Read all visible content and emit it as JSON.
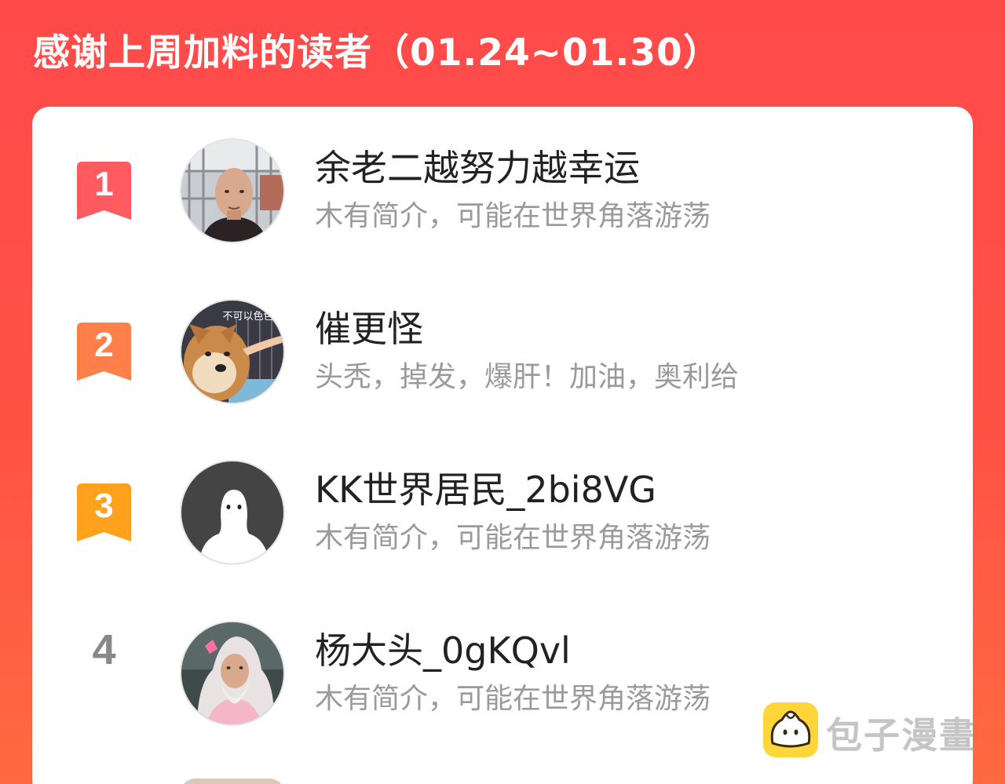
{
  "header": {
    "title": "感谢上周加料的读者（01.24~01.30）"
  },
  "readers": [
    {
      "rank": "1",
      "name": "余老二越努力越幸运",
      "bio": "木有简介，可能在世界角落游荡",
      "badge_color": "#ff5b61",
      "avatar": "photo-man-avatar"
    },
    {
      "rank": "2",
      "name": "催更怪",
      "bio": "头秃，掉发，爆肝！加油，奥利给",
      "badge_color": "#ff7f4a",
      "avatar": "shiba-dog-avatar",
      "avatar_caption": "不可以色色"
    },
    {
      "rank": "3",
      "name": "KK世界居民_2bi8VG",
      "bio": "木有简介，可能在世界角落游荡",
      "badge_color": "#ffa11c",
      "avatar": "default-ghost-avatar"
    },
    {
      "rank": "4",
      "name": "杨大头_0gKQvl",
      "bio": "木有简介，可能在世界角落游荡",
      "badge_color": "#888888",
      "avatar": "wizard-avatar"
    }
  ],
  "watermark": {
    "text": "包子漫畫",
    "logo": "bun-logo-icon"
  }
}
